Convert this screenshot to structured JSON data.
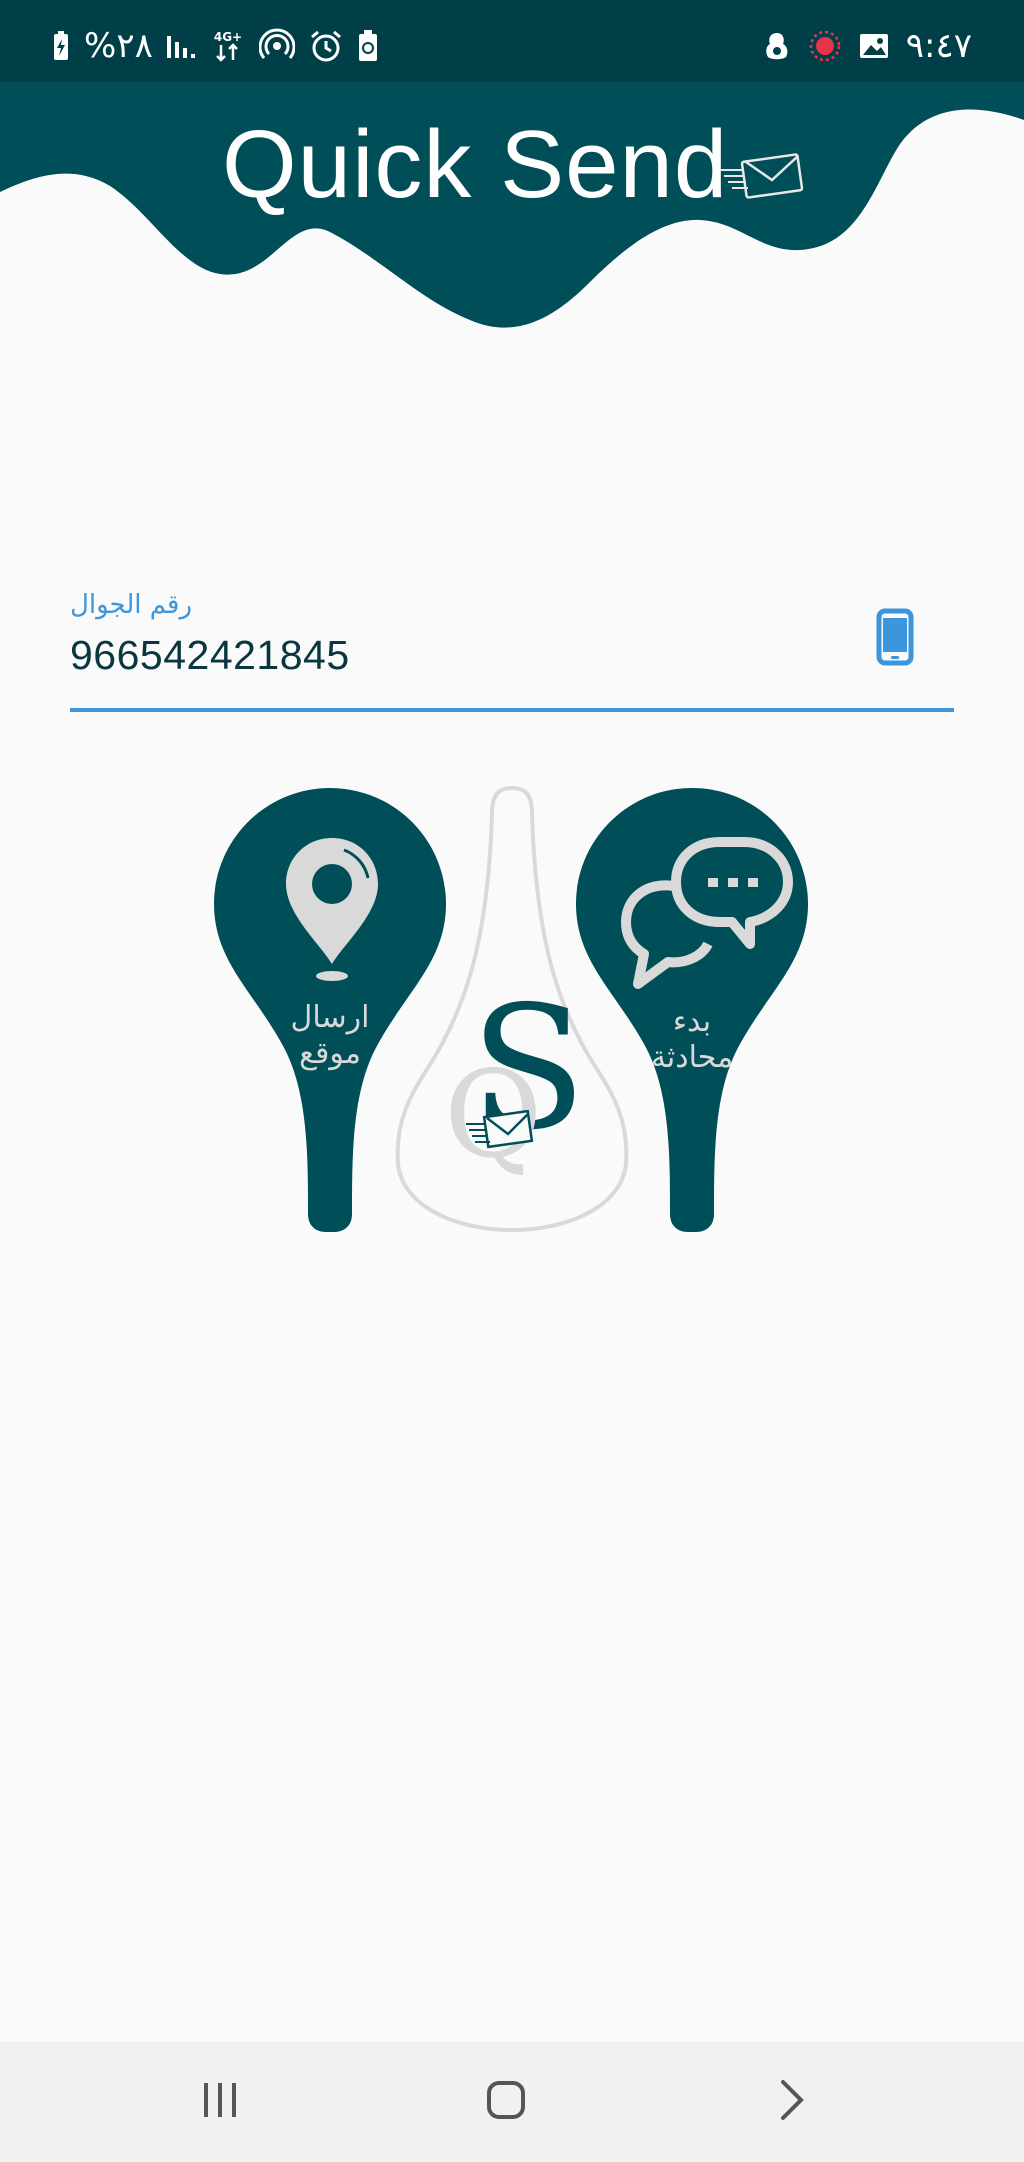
{
  "status_bar": {
    "battery_percent": "%٢٨",
    "network": "4G+",
    "time": "٩:٤٧",
    "icons": [
      "battery-charging-icon",
      "signal-bars-icon",
      "network-4g-icon",
      "hotspot-icon",
      "alarm-icon",
      "battery-saver-icon",
      "assistant-icon",
      "recording-icon",
      "gallery-icon"
    ],
    "recording_color": "#e8334a"
  },
  "header": {
    "title": "Quick Send",
    "brand_color": "#004f58",
    "icon": "envelope-icon"
  },
  "phone_field": {
    "label": "رقم الجوال",
    "value": "966542421845",
    "icon": "smartphone-icon",
    "accent_color": "#3b96dc"
  },
  "actions": {
    "send_location": {
      "line1": "ارسال",
      "line2": "موقع",
      "icon": "location-pin-icon"
    },
    "start_chat": {
      "line1": "بدء",
      "line2": "محادثة",
      "icon": "chat-bubbles-icon"
    }
  },
  "logo": {
    "letter_s": "S",
    "letter_q": "Q",
    "icon": "envelope-icon"
  },
  "nav_bar": {
    "items": [
      "recent-apps-icon",
      "home-icon",
      "back-icon"
    ]
  }
}
